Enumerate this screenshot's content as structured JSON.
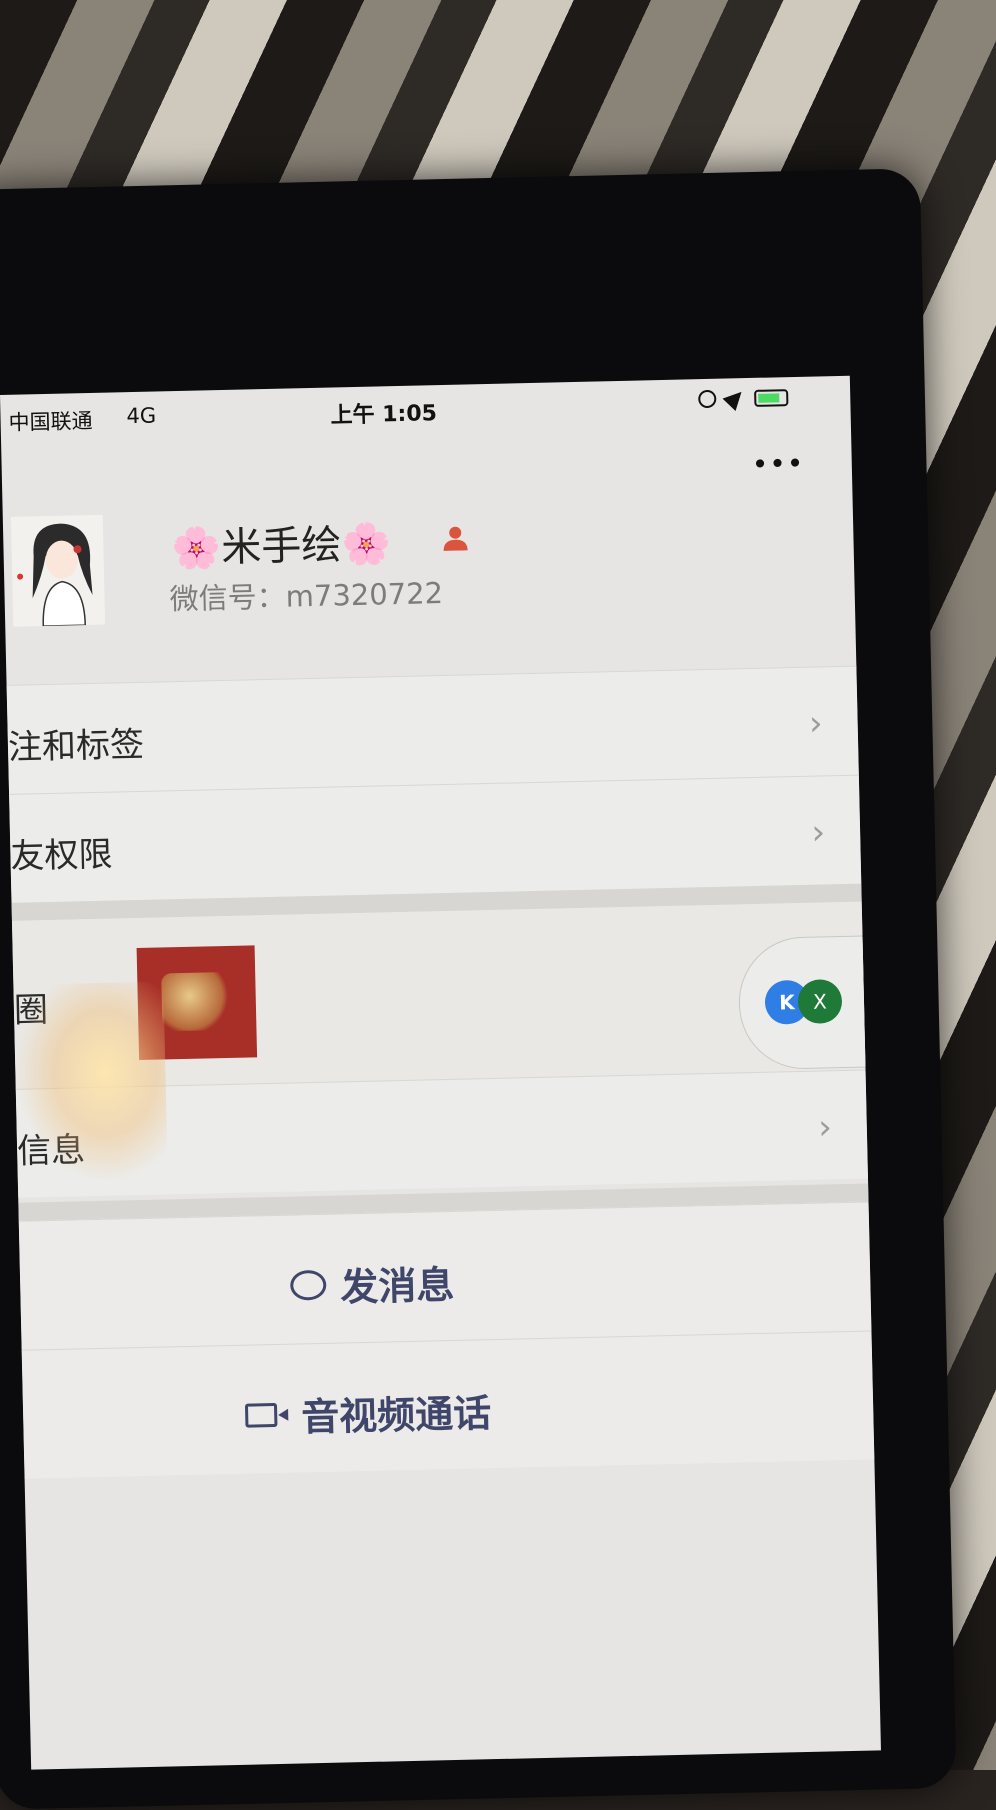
{
  "status_bar": {
    "carrier": "中国联通",
    "network": "4G",
    "time": "上午 1:05"
  },
  "header": {
    "more_label": "•••"
  },
  "profile": {
    "name_prefix_icon": "🌸",
    "name": "米手绘",
    "name_suffix_icon": "🌸",
    "wechat_id_label": "微信号：",
    "wechat_id": "m7320722"
  },
  "rows": [
    {
      "label": "注和标签",
      "chevron": "›"
    },
    {
      "label": "友权限",
      "chevron": "›"
    }
  ],
  "moments": {
    "label": "圈"
  },
  "more_info": {
    "label": "信息",
    "chevron": "›"
  },
  "floating_widget": {
    "icon_a": "K",
    "icon_b": "X"
  },
  "actions": {
    "send_message": "发消息",
    "video_call": "音视频通话"
  },
  "colors": {
    "action_text": "#40466a",
    "moments_thumb": "#a82e28"
  }
}
